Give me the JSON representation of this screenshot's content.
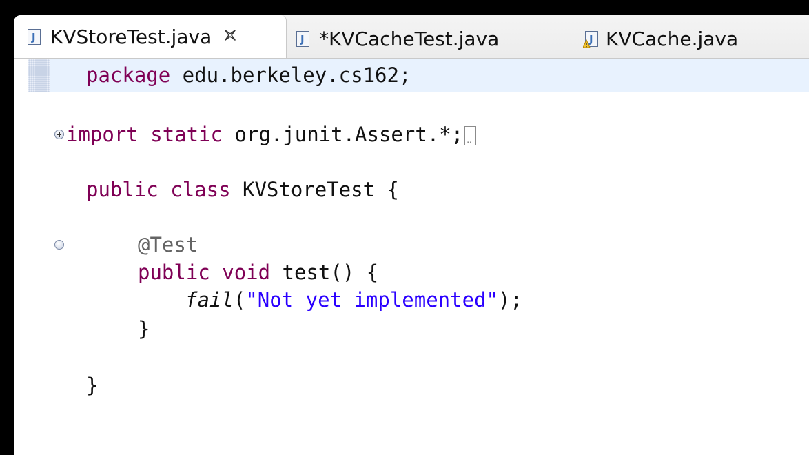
{
  "tabs": [
    {
      "label": "KVStoreTest.java",
      "close_glyph": "×",
      "icon": "java-file-icon",
      "active": true
    },
    {
      "label": "*KVCacheTest.java",
      "icon": "java-file-icon",
      "active": false
    },
    {
      "label": "KVCache.java",
      "icon": "java-file-warning-icon",
      "active": false
    }
  ],
  "code": {
    "line1": {
      "kw": "package",
      "rest": " edu.berkeley.cs162;"
    },
    "line2": {
      "kw1": "import",
      "kw2": "static",
      "rest": " org.junit.Assert.*;",
      "elide": ".."
    },
    "line3": {
      "kw1": "public",
      "kw2": "class",
      "rest": " KVStoreTest {"
    },
    "line4": {
      "annotation": "@Test"
    },
    "line5": {
      "kw1": "public",
      "kw2": "void",
      "rest": " test() {"
    },
    "line6": {
      "method": "fail",
      "open": "(",
      "str": "\"Not yet implemented\"",
      "close": ");"
    },
    "line7": {
      "text": "}"
    },
    "line8": {
      "text": "}"
    }
  },
  "colors": {
    "keyword": "#7f0055",
    "string": "#2a00ff",
    "annotation": "#646464",
    "current_line": "#e8f2fe"
  }
}
